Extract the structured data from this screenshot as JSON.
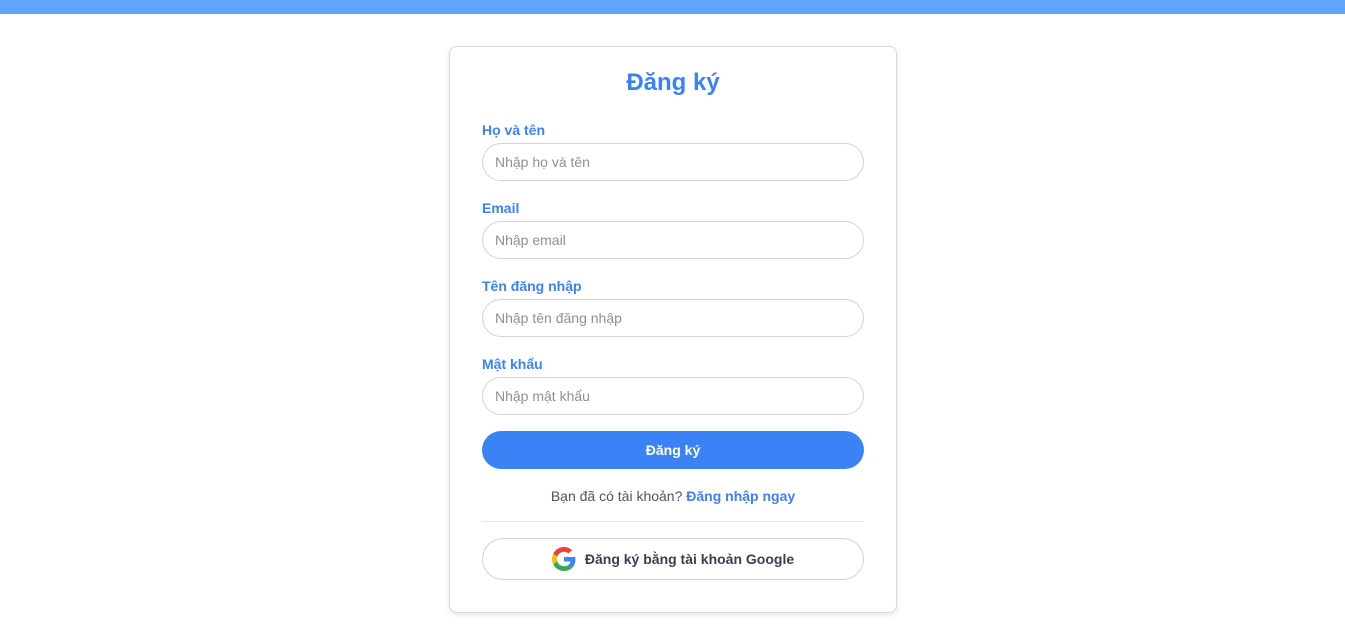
{
  "colors": {
    "accent": "#3b82f6",
    "top_bar": "#60a5fa",
    "border": "#cfd3d8",
    "text": "#374151"
  },
  "form": {
    "title": "Đăng ký",
    "fields": [
      {
        "label": "Họ và tên",
        "placeholder": "Nhập họ và tên",
        "value": ""
      },
      {
        "label": "Email",
        "placeholder": "Nhập email",
        "value": ""
      },
      {
        "label": "Tên đăng nhập",
        "placeholder": "Nhập tên đăng nhập",
        "value": ""
      },
      {
        "label": "Mật khẩu",
        "placeholder": "Nhập mật khẩu",
        "value": ""
      }
    ],
    "submit_label": "Đăng ký",
    "login_prompt": "Bạn đã có tài khoản?",
    "login_link": "Đăng nhập ngay",
    "google_label": "Đăng ký bằng tài khoản Google",
    "google_icon": "google-icon"
  }
}
